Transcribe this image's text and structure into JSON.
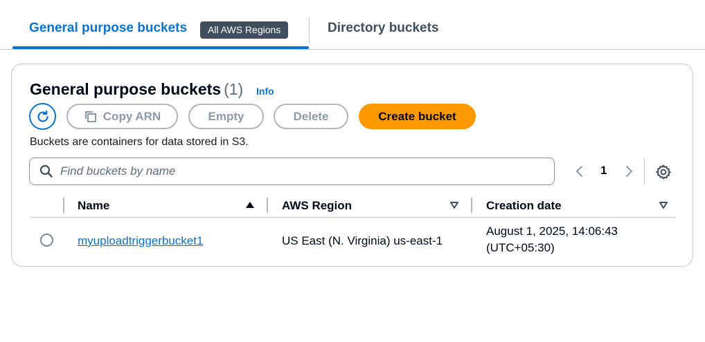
{
  "tabs": {
    "general": "General purpose buckets",
    "region_badge": "All AWS Regions",
    "directory": "Directory buckets"
  },
  "panel": {
    "title": "General purpose buckets",
    "count": "(1)",
    "info": "Info",
    "description": "Buckets are containers for data stored in S3."
  },
  "toolbar": {
    "refresh_icon": "refresh-icon",
    "copy_arn": "Copy ARN",
    "empty": "Empty",
    "delete": "Delete",
    "create": "Create bucket"
  },
  "search": {
    "placeholder": "Find buckets by name",
    "value": ""
  },
  "pagination": {
    "current_page": "1"
  },
  "table": {
    "columns": [
      {
        "label": "Name",
        "sort": "ascending"
      },
      {
        "label": "AWS Region",
        "sort": "none"
      },
      {
        "label": "Creation date",
        "sort": "none"
      }
    ],
    "rows": [
      {
        "name": "myuploadtriggerbucket1",
        "region": "US East (N. Virginia) us-east-1",
        "created_line1": "August 1, 2025, 14:06:43",
        "created_line2": "(UTC+05:30)"
      }
    ]
  },
  "colors": {
    "accent": "#0972d3",
    "primary_button": "#ff9900",
    "badge_bg": "#414d5c"
  }
}
